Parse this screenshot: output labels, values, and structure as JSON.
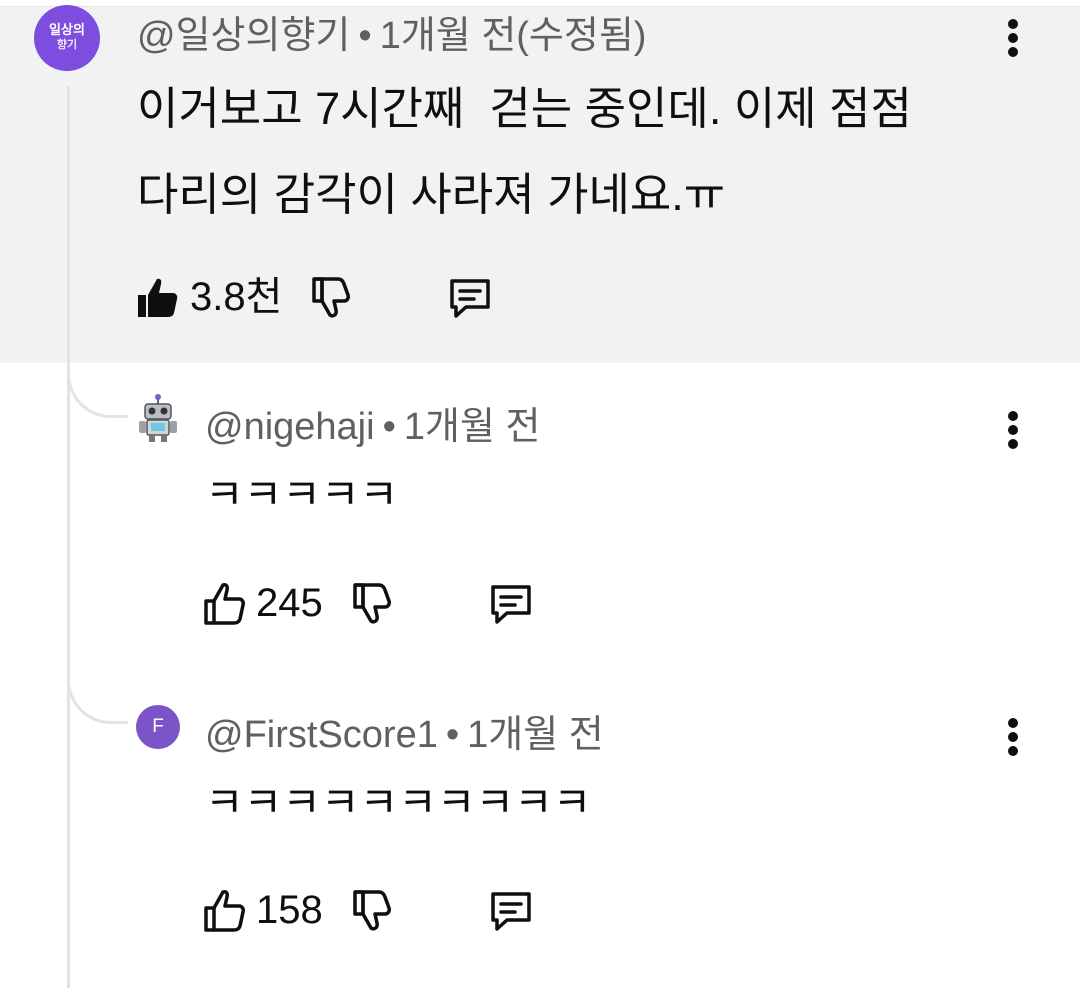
{
  "comment": {
    "author": "@일상의향기",
    "separator": "•",
    "time": "1개월 전(수정됨)",
    "avatar_line1": "일상의",
    "avatar_line2": "향기",
    "text": "이거보고 7시간째  걷는 중인데. 이제 점점\n다리의 감각이 사라져 가네요.ㅠ",
    "likes": "3.8천",
    "liked": true
  },
  "replies": [
    {
      "author": "@nigehaji",
      "separator": "•",
      "time": "1개월 전",
      "avatar": "robot-avatar",
      "text": "ㅋㅋㅋㅋㅋ",
      "likes": "245"
    },
    {
      "author": "@FirstScore1",
      "separator": "•",
      "time": "1개월 전",
      "avatar_letter": "F",
      "text": "ㅋㅋㅋㅋㅋㅋㅋㅋㅋㅋ",
      "likes": "158"
    }
  ],
  "icons": {
    "like": "thumbs-up-icon",
    "dislike": "thumbs-down-icon",
    "reply": "reply-icon",
    "menu": "more-vert-icon"
  },
  "colors": {
    "highlight_bg": "#f2f2f2",
    "meta_text": "#606060",
    "avatar_purple": "#7b54c8",
    "thread_line": "#e3e3e3"
  }
}
